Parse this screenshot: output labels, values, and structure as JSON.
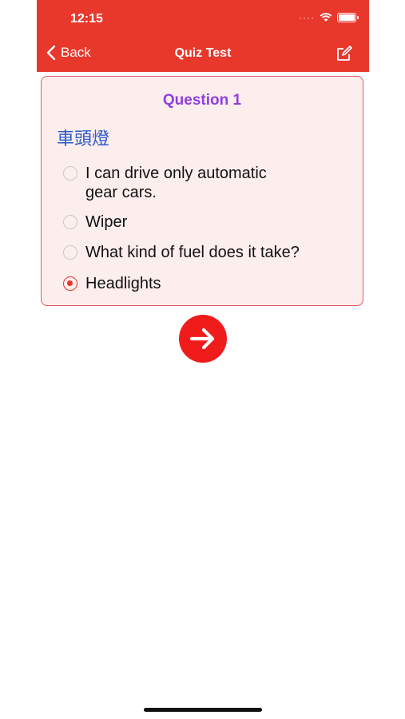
{
  "status_bar": {
    "time": "12:15",
    "signal": "····"
  },
  "nav": {
    "back_label": "Back",
    "title": "Quiz Test"
  },
  "quiz": {
    "question_label": "Question 1",
    "term": "車頭燈",
    "options": [
      {
        "label": "I can drive only automatic gear cars.",
        "selected": false
      },
      {
        "label": "Wiper",
        "selected": false
      },
      {
        "label": "What kind of fuel does it take?",
        "selected": false
      },
      {
        "label": "Headlights",
        "selected": true
      }
    ]
  },
  "colors": {
    "header": "#e8372b",
    "question_number": "#8f3ee0",
    "term": "#2d59c9",
    "next_button": "#f01c1c"
  },
  "icons": {
    "back": "chevron-left-icon",
    "edit": "compose-icon",
    "next": "arrow-right-icon"
  }
}
